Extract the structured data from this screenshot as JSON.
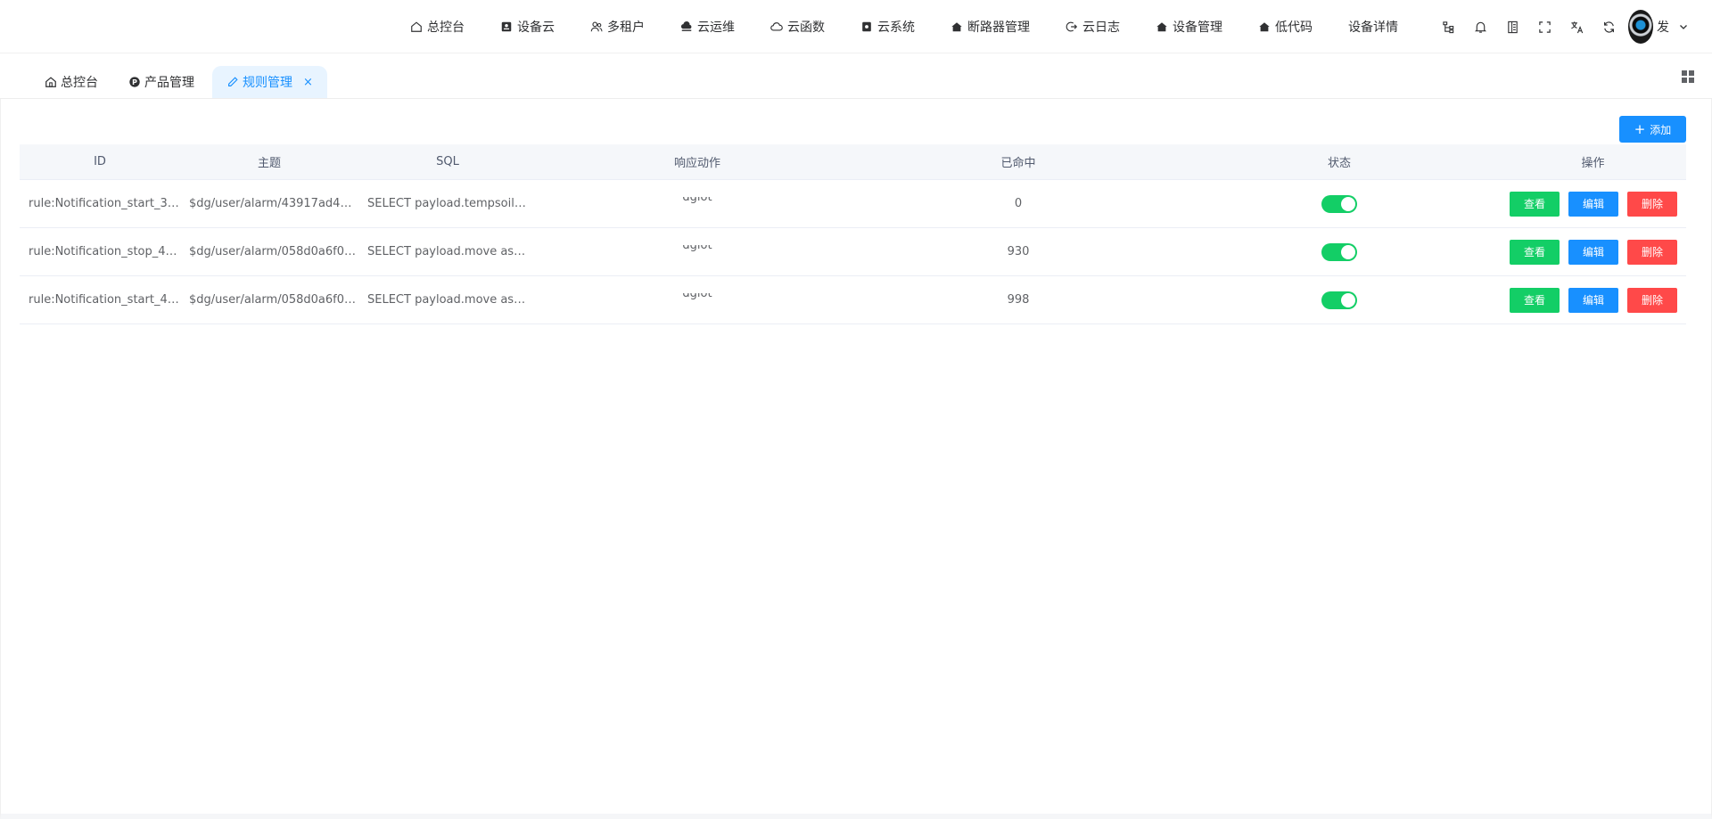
{
  "nav": {
    "items": [
      {
        "label": "总控台",
        "icon": "home-icon"
      },
      {
        "label": "设备云",
        "icon": "device-card-icon"
      },
      {
        "label": "多租户",
        "icon": "users-icon"
      },
      {
        "label": "云运维",
        "icon": "cloud-ops-icon"
      },
      {
        "label": "云函数",
        "icon": "cloud-icon"
      },
      {
        "label": "云系统",
        "icon": "system-icon"
      },
      {
        "label": "断路器管理",
        "icon": "house-fill-icon"
      },
      {
        "label": "云日志",
        "icon": "logout-icon"
      },
      {
        "label": "设备管理",
        "icon": "house-fill-icon"
      },
      {
        "label": "低代码",
        "icon": "house-fill-icon"
      },
      {
        "label": "设备详情",
        "icon": ""
      }
    ],
    "user_name": "发"
  },
  "tags": [
    {
      "label": "总控台",
      "icon": "home-icon"
    },
    {
      "label": "产品管理",
      "icon": "product-icon"
    },
    {
      "label": "规则管理",
      "icon": "pencil-icon",
      "close": "×"
    }
  ],
  "toolbar": {
    "add_label": "添加",
    "add_plus": "+"
  },
  "table": {
    "headers": {
      "id": "ID",
      "topic": "主题",
      "sql": "SQL",
      "action": "响应动作",
      "hit": "已命中",
      "state": "状态",
      "ops": "操作"
    },
    "rows": [
      {
        "id": "rule:Notification_start_3…",
        "topic": "$dg/user/alarm/43917ad4…",
        "sql": "SELECT payload.tempsoil…",
        "action": "dgiot",
        "hit": "0",
        "enabled": true
      },
      {
        "id": "rule:Notification_stop_4…",
        "topic": "$dg/user/alarm/058d0a6f0…",
        "sql": "SELECT payload.move as…",
        "action": "dgiot",
        "hit": "930",
        "enabled": true
      },
      {
        "id": "rule:Notification_start_4…",
        "topic": "$dg/user/alarm/058d0a6f0…",
        "sql": "SELECT payload.move as…",
        "action": "dgiot",
        "hit": "998",
        "enabled": true
      }
    ],
    "op_labels": {
      "view": "查看",
      "edit": "编辑",
      "delete": "删除"
    }
  },
  "colors": {
    "primary": "#1890ff",
    "success": "#13ce66",
    "danger": "#ff4949",
    "header_bg": "#f5f7fa"
  }
}
